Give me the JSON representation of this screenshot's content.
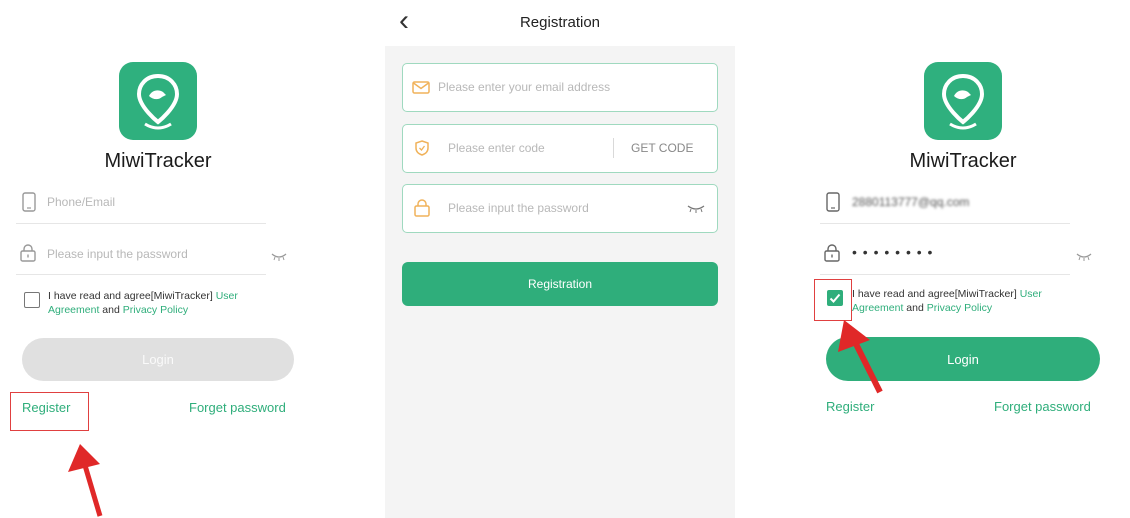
{
  "left_screen": {
    "app_name": "MiwiTracker",
    "account_placeholder": "Phone/Email",
    "password_placeholder": "Please input the password",
    "agree_text": "I have read and agree[MiwiTracker]",
    "user_agreement": "User Agreement",
    "and_text": "and",
    "privacy_policy": "Privacy Policy",
    "login_label": "Login",
    "register_label": "Register",
    "forget_label": "Forget password"
  },
  "middle_screen": {
    "title": "Registration",
    "back_symbol": "‹",
    "email_placeholder": "Please enter your email address",
    "code_placeholder": "Please enter code",
    "get_code_label": "GET CODE",
    "password_placeholder": "Please input the password",
    "registration_button": "Registration"
  },
  "right_screen": {
    "app_name": "MiwiTracker",
    "account_value": "2880113777@qq.com",
    "password_mask": "• • • • • • • •",
    "agree_text": "I have read and agree[MiwiTracker]",
    "user_agreement": "User Agreement",
    "and_text": "and",
    "privacy_policy": "Privacy Policy",
    "checkbox_checked": true,
    "login_label": "Login",
    "register_label": "Register",
    "forget_label": "Forget password"
  },
  "colors": {
    "brand": "#2fae7b",
    "field_border": "#9fd9bf",
    "highlight_box": "#e04040",
    "arrow": "#e02828"
  },
  "icons": [
    "location-pin-icon",
    "phone-icon",
    "lock-icon",
    "eye-closed-icon",
    "mail-icon",
    "shield-icon",
    "back-arrow-icon",
    "checkmark-icon",
    "red-arrow-annotation"
  ]
}
